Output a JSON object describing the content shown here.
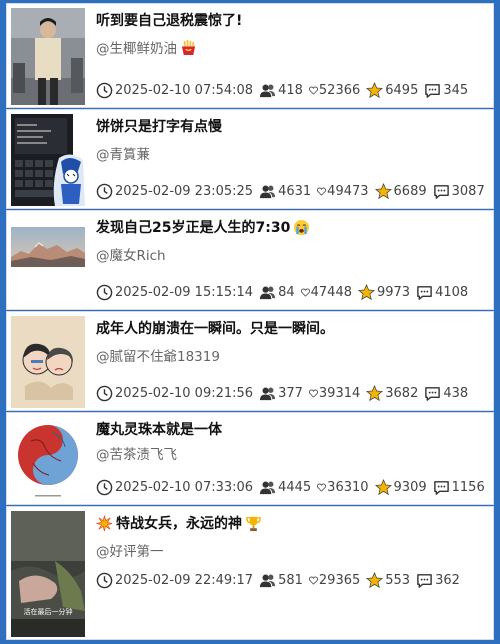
{
  "posts": [
    {
      "title": "听到要自己退税震惊了!",
      "title_emoji": "",
      "author": "@生椰鲜奶油",
      "author_emoji": "fries-icon",
      "time": "2025-02-10 07:54:08",
      "followers": "418",
      "likes": "52366",
      "stars": "6495",
      "comments": "345"
    },
    {
      "title": "饼饼只是打字有点慢",
      "title_emoji": "",
      "author": "@青篔蒹",
      "author_emoji": "",
      "time": "2025-02-09 23:05:25",
      "followers": "4631",
      "likes": "49473",
      "stars": "6689",
      "comments": "3087"
    },
    {
      "title": "发现自己25岁正是人生的7:30",
      "title_emoji": "crying-face-icon",
      "author": "@魔女Rich",
      "author_emoji": "",
      "time": "2025-02-09 15:15:14",
      "followers": "84",
      "likes": "47448",
      "stars": "9973",
      "comments": "4108"
    },
    {
      "title": "成年人的崩溃在一瞬间。只是一瞬间。",
      "title_emoji": "",
      "author": "@腻留不住爺18319",
      "author_emoji": "",
      "time": "2025-02-10 09:21:56",
      "followers": "377",
      "likes": "39314",
      "stars": "3682",
      "comments": "438"
    },
    {
      "title": "魔丸灵珠本就是一体",
      "title_emoji": "",
      "author": "@苦茶渍飞飞",
      "author_emoji": "",
      "time": "2025-02-10 07:33:06",
      "followers": "4445",
      "likes": "36310",
      "stars": "9309",
      "comments": "1156"
    },
    {
      "title": " 特战女兵，永远的神",
      "title_emoji": "trophy-icon",
      "title_lead_emoji": "collision-icon",
      "author": "@好评第一",
      "author_emoji": "",
      "time": "2025-02-09 22:49:17",
      "followers": "581",
      "likes": "29365",
      "stars": "553",
      "comments": "362"
    }
  ],
  "thumb_captions": {
    "post6": "活在最后一分钟"
  },
  "colors": {
    "frame": "#2f6fbf",
    "star": "#f5b400",
    "text": "#111111",
    "meta": "#444444"
  }
}
